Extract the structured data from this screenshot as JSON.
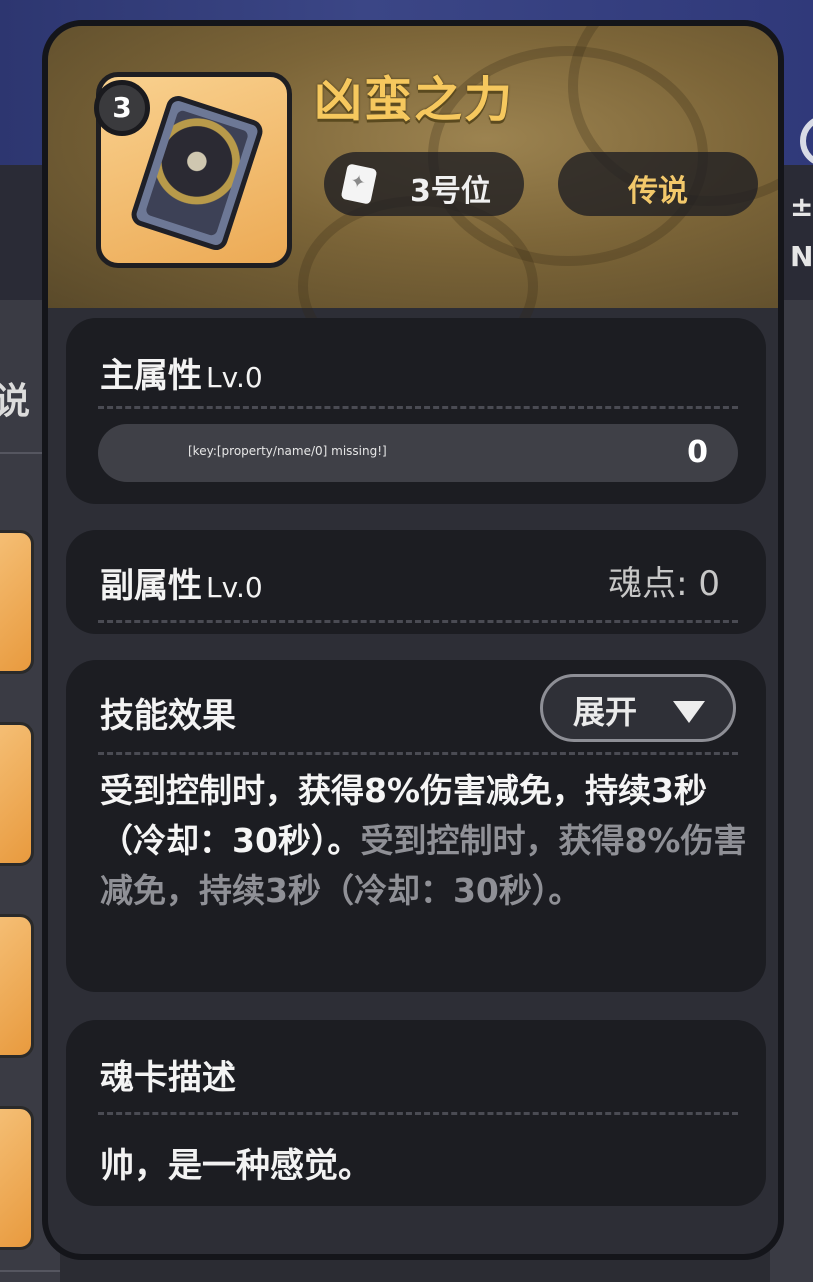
{
  "card": {
    "title": "凶蛮之力",
    "level": "3",
    "slot_label": "3号位",
    "rarity": "传说"
  },
  "main_attr": {
    "title": "主属性",
    "level": "Lv.0",
    "property_name": "[key:[property/name/0] missing!]",
    "property_value": "0"
  },
  "sub_attr": {
    "title": "副属性",
    "level": "Lv.0",
    "soul_points": "魂点: 0"
  },
  "skill": {
    "title": "技能效果",
    "expand_label": "展开",
    "text_active": "受到控制时，获得8%伤害减免，持续3秒（冷却：30秒）。",
    "text_dim": "受到控制时，获得8%伤害减免，持续3秒（冷却：30秒）。"
  },
  "description": {
    "title": "魂卡描述",
    "text": "帅，是一种感觉。"
  },
  "background": {
    "left_glyph": "说",
    "right_glyph_1": "±",
    "right_glyph_2": "N"
  },
  "colors": {
    "title_gold": "#f6c85e",
    "rarity_gold": "#f2c86a",
    "panel_bg": "#2d2e36",
    "section_bg": "#1c1d22",
    "dim_text": "#8f9096"
  },
  "icons": {
    "slot": "card-slot-icon",
    "expand": "triangle-down-icon"
  }
}
